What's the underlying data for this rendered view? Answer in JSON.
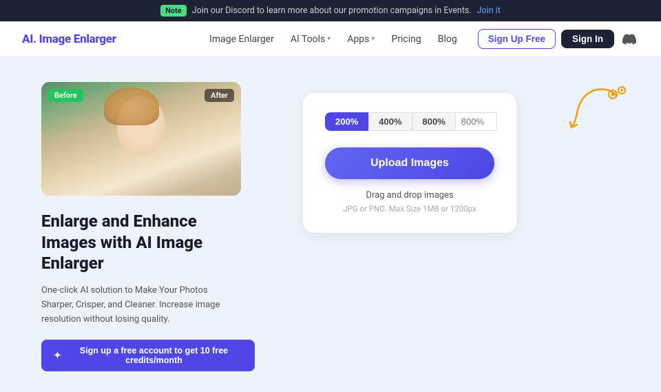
{
  "announcement": {
    "badge": "Note",
    "text": "Join our Discord to learn more about our promotion campaigns in Events.",
    "link_text": "Join it",
    "link_url": "#"
  },
  "nav": {
    "logo": "AI. Image Enlarger",
    "links": [
      {
        "label": "Image Enlarger",
        "has_dropdown": false
      },
      {
        "label": "AI Tools",
        "has_dropdown": true
      },
      {
        "label": "Apps",
        "has_dropdown": true
      },
      {
        "label": "Pricing",
        "has_dropdown": false
      },
      {
        "label": "Blog",
        "has_dropdown": false
      }
    ],
    "btn_signup_free": "Sign Up Free",
    "btn_signin": "Sign In"
  },
  "hero": {
    "before_label": "Before",
    "after_label": "After",
    "title": "Enlarge and Enhance Images with AI Image Enlarger",
    "description": "One-click AI solution to Make Your Photos Sharper, Crisper, and Cleaner. Increase image resolution without losing quality.",
    "cta_button": "Sign up a free account to get 10 free credits/month"
  },
  "upload_card": {
    "zoom_options": [
      "200%",
      "400%",
      "800%"
    ],
    "zoom_active": "200%",
    "zoom_placeholder": "800%",
    "upload_button": "Upload Images",
    "drag_drop_text": "Drag and drop images",
    "file_info": "JPG or PNG. Max Size 1MB or 1200px"
  }
}
